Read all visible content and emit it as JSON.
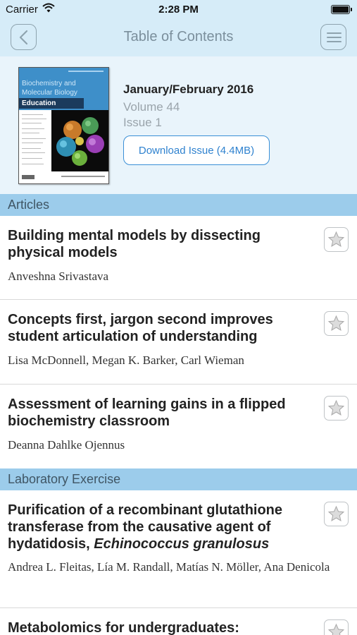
{
  "status_bar": {
    "carrier": "Carrier",
    "time": "2:28 PM",
    "wifi_icon": "wifi-icon",
    "battery_icon": "battery-icon"
  },
  "nav": {
    "title": "Table of Contents",
    "back_icon": "chevron-left-icon",
    "menu_icon": "hamburger-menu-icon"
  },
  "issue": {
    "cover": {
      "title_line1": "Biochemistry and",
      "title_line2": "Molecular Biology",
      "title_line3": "Education"
    },
    "date": "January/February 2016",
    "volume": "Volume 44",
    "issue": "Issue 1",
    "download_label": "Download Issue (4.4MB)"
  },
  "sections": [
    {
      "name": "Articles",
      "articles": [
        {
          "title": "Building mental models by dissecting physical models",
          "authors": "Anveshna Srivastava"
        },
        {
          "title": "Concepts first, jargon second improves student articulation of understanding",
          "authors": "Lisa McDonnell, Megan K. Barker, Carl Wieman"
        },
        {
          "title": "Assessment of learning gains in a flipped biochemistry classroom",
          "authors": "Deanna Dahlke Ojennus"
        }
      ]
    },
    {
      "name": "Laboratory Exercise",
      "articles": [
        {
          "title": "Purification of a recombinant glutathione transferase from the causative agent of hydatidosis,",
          "title_italic": "Echinococcus granulosus",
          "authors": "Andrea L. Fleitas, Lía M. Randall, Matías N. Möller, Ana Denicola"
        },
        {
          "title": "Metabolomics for undergraduates:",
          "authors": ""
        }
      ]
    }
  ],
  "colors": {
    "nav_bg": "#d6ecf8",
    "header_bg": "#e9f4fb",
    "section_bg": "#9ccceb",
    "accent": "#2f82cf"
  }
}
